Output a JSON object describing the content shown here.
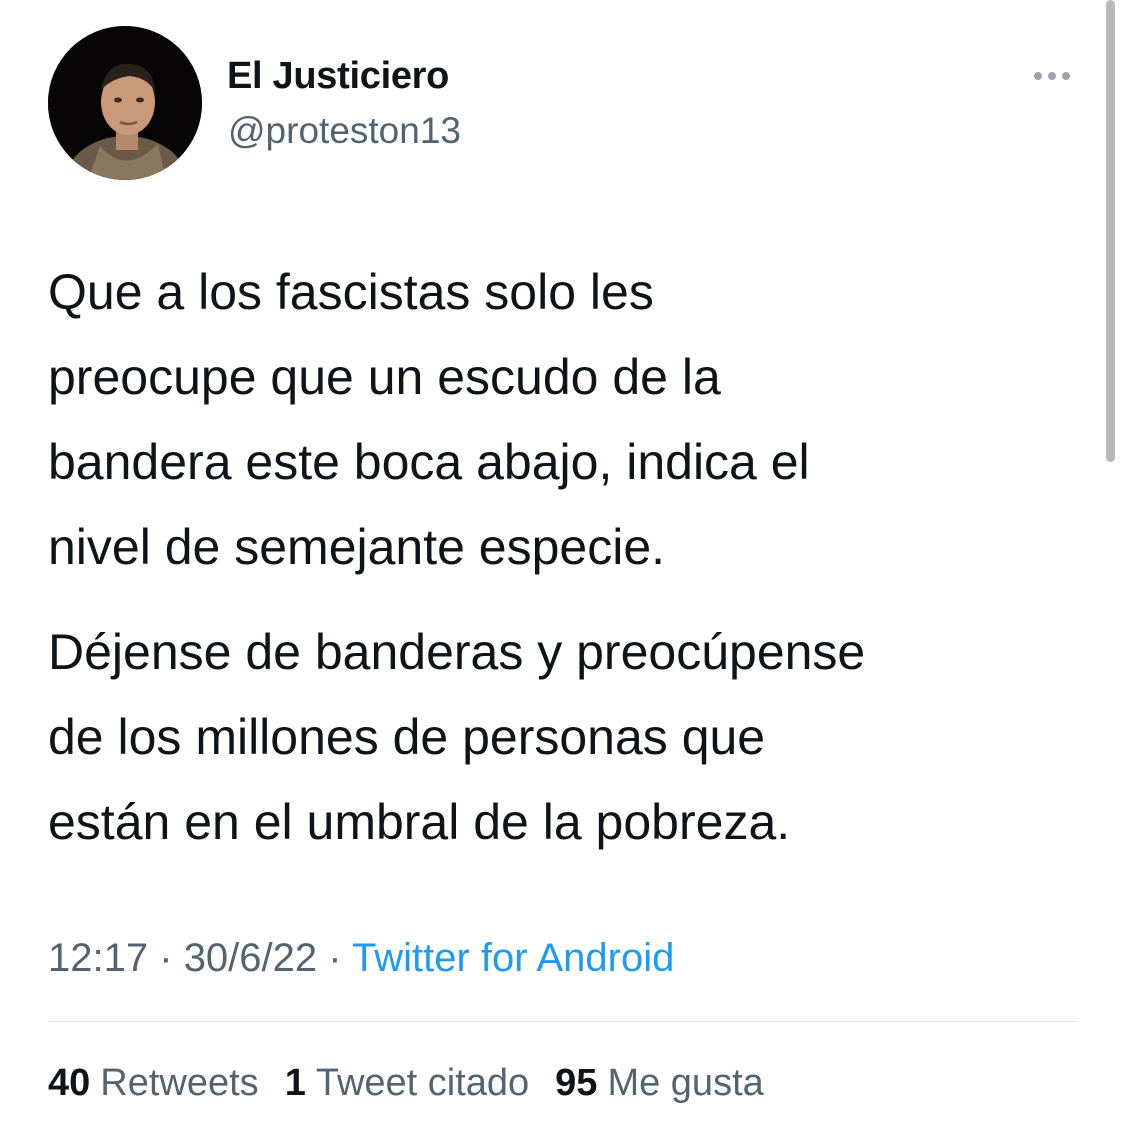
{
  "user": {
    "display_name": "El Justiciero",
    "handle": "@proteston13"
  },
  "tweet": {
    "paragraphs": [
      "Que a los fascistas solo les\npreocupe que un escudo de la\nbandera este boca abajo, indica el\nnivel de semejante especie.",
      "Déjense de banderas y preocúpense\nde los millones de personas que\nestán en el umbral de la pobreza."
    ],
    "time": "12:17",
    "date": "30/6/22",
    "separator": "·",
    "source": "Twitter for Android"
  },
  "stats": {
    "retweets_count": "40",
    "retweets_label": "Retweets",
    "quotes_count": "1",
    "quotes_label": "Tweet citado",
    "likes_count": "95",
    "likes_label": "Me gusta"
  },
  "icons": {
    "more": "more-options-icon",
    "avatar": "profile-photo"
  },
  "colors": {
    "text": "#0f1419",
    "secondary": "#536471",
    "link": "#1d9bf0"
  }
}
